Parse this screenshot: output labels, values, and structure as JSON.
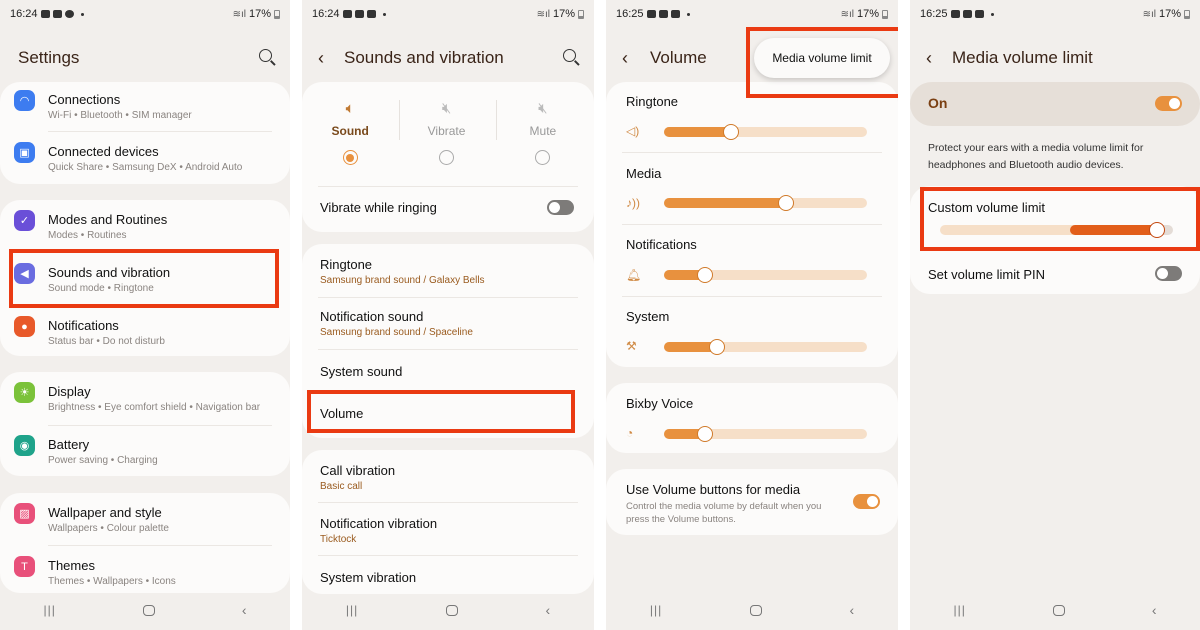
{
  "colors": {
    "accent": "#e8913e",
    "highlight": "#ea3a12",
    "limit_fill": "#e25e1a",
    "background": "#f2efec",
    "card": "#fcfbfa"
  },
  "screens": [
    {
      "status": {
        "time": "16:24",
        "battery": "17%"
      },
      "title": "Settings",
      "groups": [
        {
          "items": [
            {
              "icon": "wifi-icon",
              "color": "#3d7cf0",
              "label": "Connections",
              "sub": "Wi-Fi  •  Bluetooth  •  SIM manager"
            },
            {
              "icon": "connected-devices-icon",
              "color": "#3d7cf0",
              "label": "Connected devices",
              "sub": "Quick Share  •  Samsung DeX  •  Android Auto"
            }
          ]
        },
        {
          "items": [
            {
              "icon": "routines-icon",
              "color": "#6a4fd8",
              "label": "Modes and Routines",
              "sub": "Modes  •  Routines"
            },
            {
              "icon": "sound-icon",
              "color": "#6a6ce0",
              "label": "Sounds and vibration",
              "sub": "Sound mode  •  Ringtone",
              "highlighted": true
            },
            {
              "icon": "notifications-icon",
              "color": "#e8592a",
              "label": "Notifications",
              "sub": "Status bar  •  Do not disturb"
            }
          ]
        },
        {
          "items": [
            {
              "icon": "display-icon",
              "color": "#7bc23a",
              "label": "Display",
              "sub": "Brightness  •  Eye comfort shield  •  Navigation bar"
            },
            {
              "icon": "battery-icon",
              "color": "#1fa38a",
              "label": "Battery",
              "sub": "Power saving  •  Charging"
            }
          ]
        },
        {
          "items": [
            {
              "icon": "wallpaper-icon",
              "color": "#e8507a",
              "label": "Wallpaper and style",
              "sub": "Wallpapers  •  Colour palette"
            },
            {
              "icon": "themes-icon",
              "color": "#e8507a",
              "label": "Themes",
              "sub": "Themes  •  Wallpapers  •  Icons"
            }
          ]
        }
      ]
    },
    {
      "status": {
        "time": "16:24",
        "battery": "17%"
      },
      "title": "Sounds and vibration",
      "modes": [
        {
          "icon": "speaker-icon",
          "label": "Sound",
          "selected": true
        },
        {
          "icon": "vibrate-icon",
          "label": "Vibrate",
          "selected": false
        },
        {
          "icon": "mute-icon",
          "label": "Mute",
          "selected": false
        }
      ],
      "vibrate_while_ringing": {
        "label": "Vibrate while ringing",
        "on": false
      },
      "sound_items": [
        {
          "label": "Ringtone",
          "sub": "Samsung brand sound / Galaxy Bells"
        },
        {
          "label": "Notification sound",
          "sub": "Samsung brand sound / Spaceline"
        },
        {
          "label": "System sound",
          "sub": ""
        },
        {
          "label": "Volume",
          "sub": "",
          "highlighted": true
        }
      ],
      "vibration_items": [
        {
          "label": "Call vibration",
          "sub": "Basic call"
        },
        {
          "label": "Notification vibration",
          "sub": "Ticktock"
        },
        {
          "label": "System vibration",
          "sub": ""
        }
      ]
    },
    {
      "status": {
        "time": "16:25",
        "battery": "17%"
      },
      "title": "Volume",
      "popup_menu": {
        "label": "Media volume limit",
        "highlighted": true
      },
      "volumes": [
        {
          "label": "Ringtone",
          "icon": "speaker-icon",
          "level": 0.33
        },
        {
          "label": "Media",
          "icon": "music-note-icon",
          "level": 0.6
        },
        {
          "label": "Notifications",
          "icon": "bell-icon",
          "level": 0.2
        },
        {
          "label": "System",
          "icon": "wrench-icon",
          "level": 0.26
        }
      ],
      "bixby": {
        "label": "Bixby Voice",
        "icon": "bixby-icon",
        "level": 0.2
      },
      "volume_buttons": {
        "label": "Use Volume buttons for media",
        "sub": "Control the media volume by default when you press the Volume buttons.",
        "on": true
      }
    },
    {
      "status": {
        "time": "16:25",
        "battery": "17%"
      },
      "title": "Media volume limit",
      "master": {
        "label": "On",
        "on": true
      },
      "description": "Protect your ears with a media volume limit for headphones and Bluetooth audio devices.",
      "custom_limit": {
        "label": "Custom volume limit",
        "level": 0.93,
        "fill_start": 0.56,
        "highlighted": true
      },
      "pin": {
        "label": "Set volume limit PIN",
        "on": false
      }
    }
  ],
  "navbar": {
    "recents": "|||",
    "back": "‹"
  }
}
